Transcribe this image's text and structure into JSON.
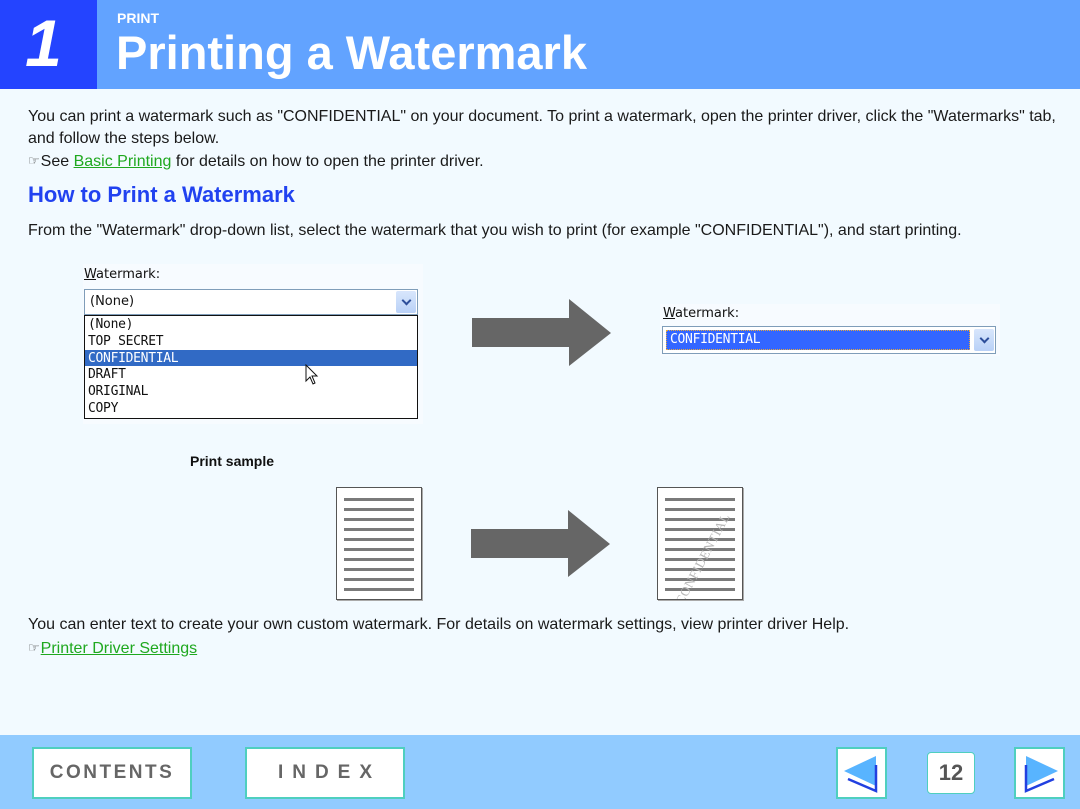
{
  "header": {
    "chapter_number": "1",
    "section_label": "PRINT",
    "title": "Printing a Watermark"
  },
  "intro": {
    "text": "You can print a watermark such as \"CONFIDENTIAL\" on your document. To print a watermark, open the printer driver, click the \"Watermarks\" tab, and follow the steps below.",
    "ref_prefix": "See ",
    "ref_link": "Basic Printing",
    "ref_suffix": " for details on how to open the printer driver.",
    "pointer_icon": "pointing-hand-icon"
  },
  "howto": {
    "heading": "How to Print a Watermark",
    "text": "From the \"Watermark\" drop-down list, select the watermark that you wish to print (for example \"CONFIDENTIAL\"), and start printing."
  },
  "dropdown_open": {
    "label_accesskey": "W",
    "label_rest": "atermark:",
    "current_value": "(None)",
    "options": [
      "(None)",
      "TOP SECRET",
      "CONFIDENTIAL",
      "DRAFT",
      "ORIGINAL",
      "COPY"
    ],
    "highlighted_option": "CONFIDENTIAL"
  },
  "dropdown_selected": {
    "label_accesskey": "W",
    "label_rest": "atermark:",
    "value": "CONFIDENTIAL"
  },
  "print_sample": {
    "label": "Print sample",
    "watermark_text": "CONFIDENTIAL"
  },
  "custom": {
    "text": "You can enter text to create your own custom watermark. For details on watermark settings, view printer driver Help.",
    "ref_link": "Printer Driver Settings"
  },
  "footer": {
    "contents_label": "CONTENTS",
    "index_label": "INDEX",
    "page_number": "12",
    "prev_icon": "previous-page-icon",
    "next_icon": "next-page-icon"
  },
  "colors": {
    "header_bg": "#62a3ff",
    "chapter_bg": "#2444ff",
    "heading": "#2142f0",
    "link": "#1fa81f",
    "footer_bg": "#91cbff",
    "button_border": "#4fcfbf",
    "selection": "#316ac5"
  }
}
